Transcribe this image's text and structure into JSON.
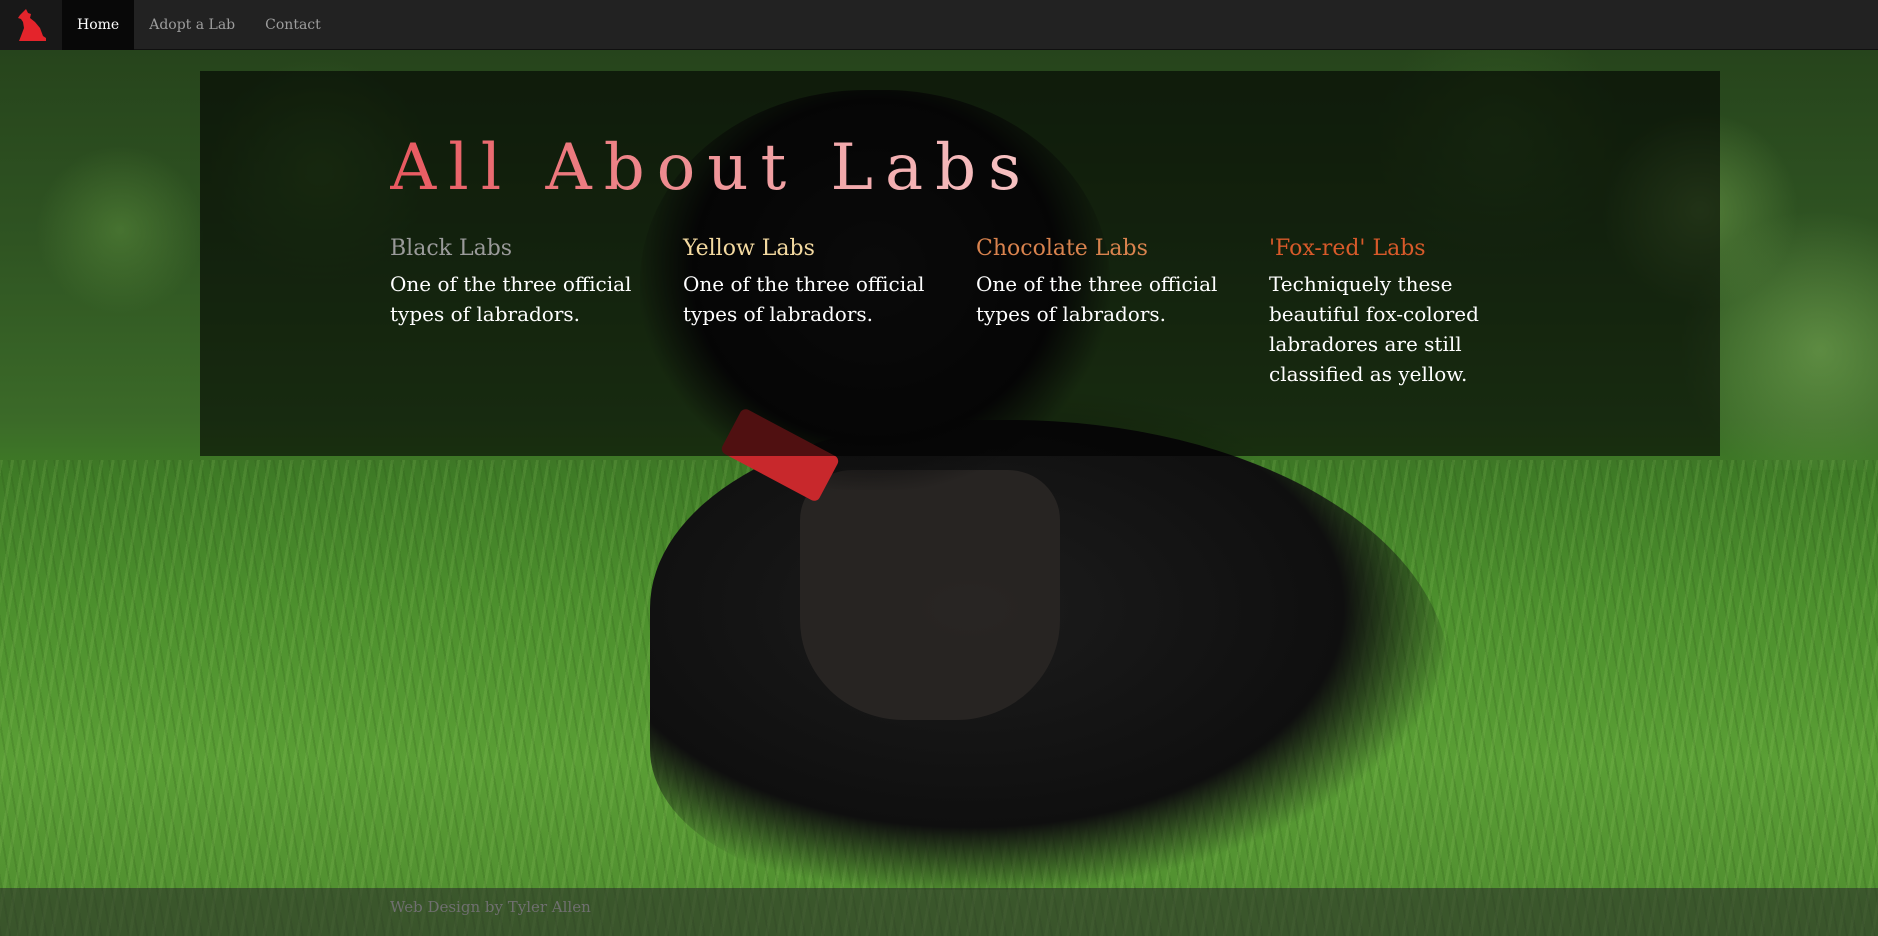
{
  "navbar": {
    "logo_icon": "dog-sitting-icon",
    "items": [
      {
        "label": "Home",
        "active": true
      },
      {
        "label": "Adopt a Lab",
        "active": false
      },
      {
        "label": "Contact",
        "active": false
      }
    ]
  },
  "hero": {
    "title": "All About Labs",
    "types": [
      {
        "title": "Black Labs",
        "color": "#9a9a9a",
        "description": "One of the three official types of labradors."
      },
      {
        "title": "Yellow Labs",
        "color": "#f3d9a0",
        "description": "One of the three official types of labradors."
      },
      {
        "title": "Chocolate Labs",
        "color": "#d9834e",
        "description": "One of the three official types of labradors."
      },
      {
        "title": "'Fox-red' Labs",
        "color": "#d85a2a",
        "description": "Techniquely these beautiful fox-colored labradores are still classified as yellow."
      }
    ]
  },
  "footer": {
    "text": "Web Design by Tyler Allen"
  },
  "colors": {
    "navbar_bg": "#222222",
    "logo_red": "#e4242b",
    "title_pink": "#e8696f"
  }
}
